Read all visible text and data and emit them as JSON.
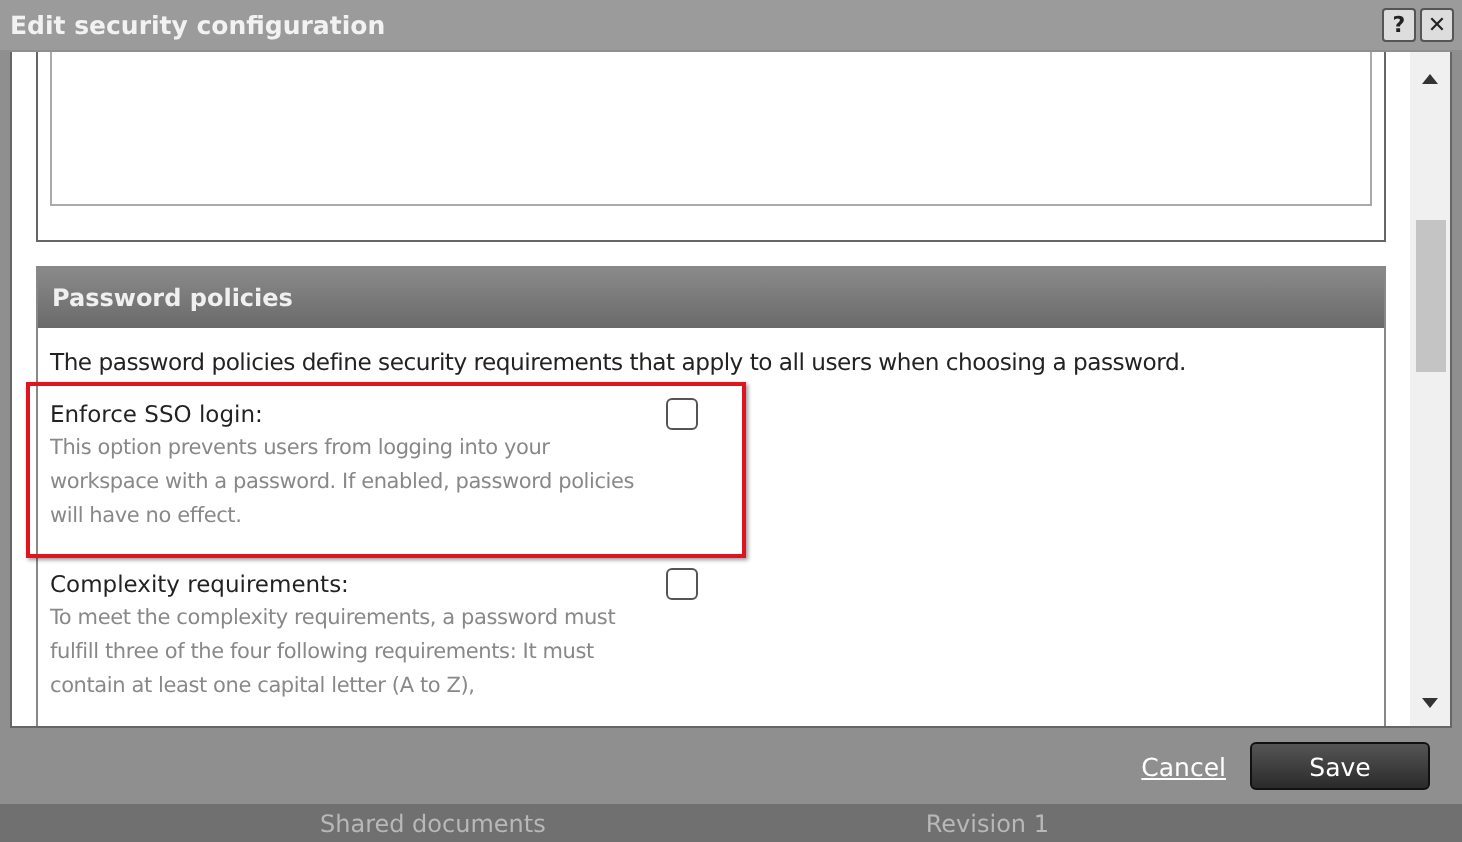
{
  "window": {
    "title": "Edit security configuration",
    "buttons": [
      "?",
      "✕"
    ]
  },
  "section": {
    "title": "Password policies",
    "intro": "The password policies define security requirements that apply to all users when choosing a password."
  },
  "options": [
    {
      "label": "Enforce SSO login:",
      "description": "This option prevents users from logging into your workspace with a password. If enabled, password policies will have no effect.",
      "checked": false,
      "highlighted": true
    },
    {
      "label": "Complexity requirements:",
      "description": "To meet the complexity requirements, a password must fulfill three of the four following requirements: It must contain at least one capital letter (A to Z),",
      "checked": false,
      "highlighted": false
    }
  ],
  "footer": {
    "cancel": "Cancel",
    "save": "Save"
  },
  "background": {
    "items": [
      "Shared documents",
      "Revision 1"
    ]
  }
}
